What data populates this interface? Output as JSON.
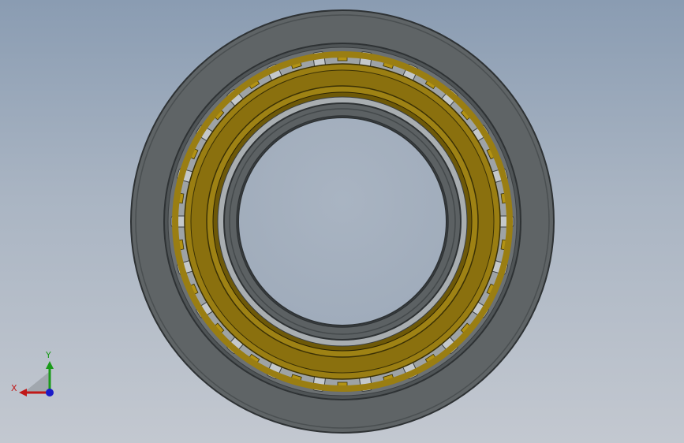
{
  "viewport": {
    "background_top": "#8a9cb2",
    "background_bottom": "#c3c8d0"
  },
  "model": {
    "name": "",
    "colors": {
      "outer_ring": "#5f6466",
      "outer_ring_edge": "#2e3234",
      "inner_ring": "#5c6163",
      "cage": "#9a7e12",
      "cage_dark": "#6e5908",
      "rollers": "#b8bcbf",
      "bore": "#a6b2c1"
    }
  },
  "triad": {
    "x_label": "X",
    "y_label": "Y",
    "x_color": "#c01818",
    "y_color": "#1a9a1a",
    "z_color": "#1a1ac8"
  }
}
